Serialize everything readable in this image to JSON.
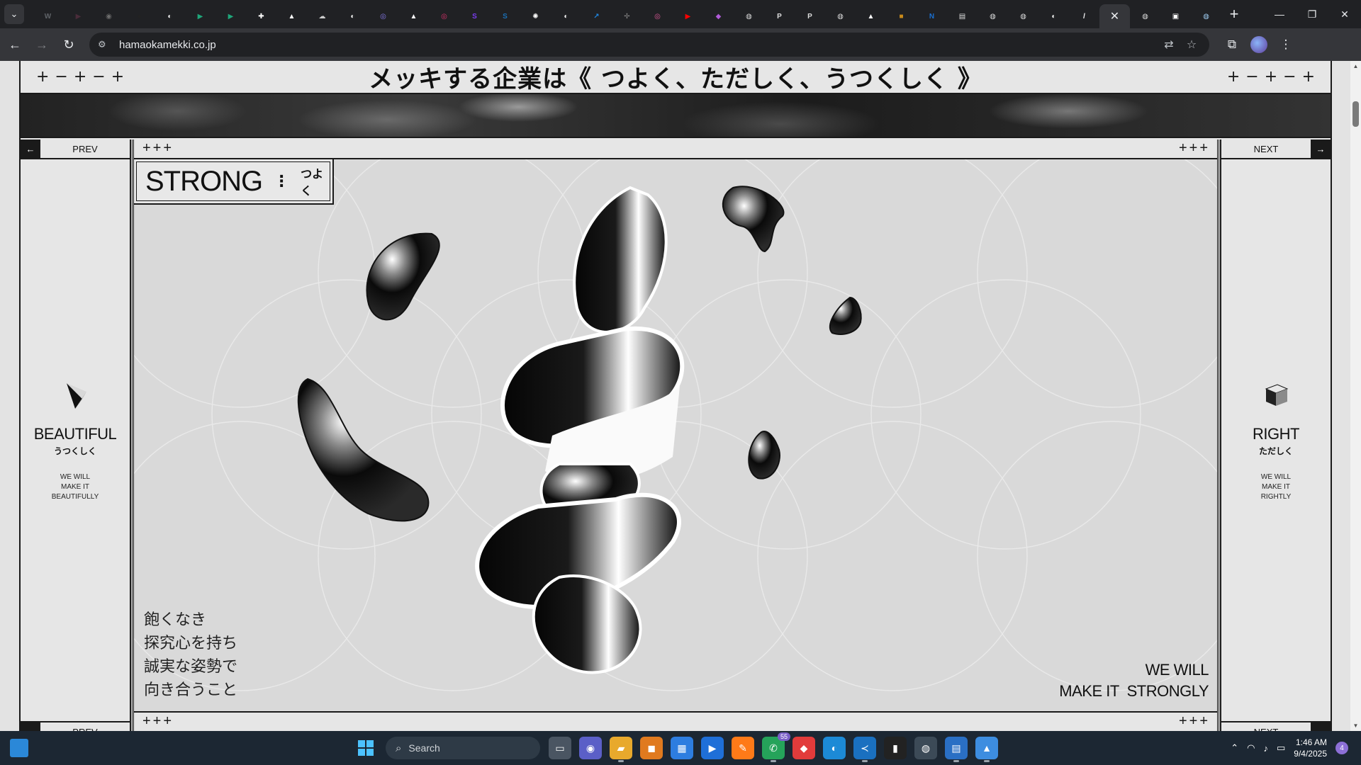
{
  "browser": {
    "tabs": [
      {
        "icon": "tab-search",
        "color": "#5f6368"
      },
      {
        "icon": "w-logo-icon",
        "glyph": "W",
        "color": "#5f6368"
      },
      {
        "icon": "video-icon",
        "glyph": "▶",
        "color": "#4a2c3a"
      },
      {
        "icon": "circle-icon",
        "glyph": "◉",
        "color": "#6b6b6b"
      },
      {
        "icon": "dark-circle-icon",
        "glyph": "●",
        "color": "#222"
      },
      {
        "icon": "github-icon",
        "glyph": "◐",
        "color": "#ffffff"
      },
      {
        "icon": "play-icon",
        "glyph": "▶",
        "color": "#1fa67a"
      },
      {
        "icon": "play-icon",
        "glyph": "▶",
        "color": "#1fa67a"
      },
      {
        "icon": "plus-box-icon",
        "glyph": "✚",
        "color": "#ffffff"
      },
      {
        "icon": "triangle-icon",
        "glyph": "▲",
        "color": "#ffffff"
      },
      {
        "icon": "cloud-icon",
        "glyph": "☁",
        "color": "#cccccc"
      },
      {
        "icon": "github-icon",
        "glyph": "◐",
        "color": "#ffffff"
      },
      {
        "icon": "ring-icon",
        "glyph": "◎",
        "color": "#8a7cf0"
      },
      {
        "icon": "triangle-icon",
        "glyph": "▲",
        "color": "#ffffff"
      },
      {
        "icon": "instagram-icon",
        "glyph": "◎",
        "color": "#e1306c"
      },
      {
        "icon": "s-logo-icon",
        "glyph": "S",
        "color": "#7a3cf0"
      },
      {
        "icon": "s-box-icon",
        "glyph": "S",
        "color": "#1b6fb5"
      },
      {
        "icon": "openai-icon",
        "glyph": "✺",
        "color": "#ffffff"
      },
      {
        "icon": "github-icon",
        "glyph": "◐",
        "color": "#ffffff"
      },
      {
        "icon": "chart-icon",
        "glyph": "↗",
        "color": "#1e88e5"
      },
      {
        "icon": "puzzle-icon",
        "glyph": "✢",
        "color": "#888888"
      },
      {
        "icon": "ring-icon",
        "glyph": "◎",
        "color": "#e05a9a"
      },
      {
        "icon": "youtube-icon",
        "glyph": "▶",
        "color": "#ff0000"
      },
      {
        "icon": "gradient-icon",
        "glyph": "◆",
        "color": "#b05ad8"
      },
      {
        "icon": "globe-icon",
        "glyph": "◍",
        "color": "#dddddd"
      },
      {
        "icon": "p-icon",
        "glyph": "P",
        "color": "#dddddd"
      },
      {
        "icon": "p-icon",
        "glyph": "P",
        "color": "#dddddd"
      },
      {
        "icon": "globe-icon",
        "glyph": "◍",
        "color": "#dddddd"
      },
      {
        "icon": "triangle-icon",
        "glyph": "▲",
        "color": "#ffffff"
      },
      {
        "icon": "orange-box-icon",
        "glyph": "■",
        "color": "#c98a1a"
      },
      {
        "icon": "n-box-icon",
        "glyph": "N",
        "color": "#1a6fd0"
      },
      {
        "icon": "news-icon",
        "glyph": "▤",
        "color": "#dddddd"
      },
      {
        "icon": "globe-icon",
        "glyph": "◍",
        "color": "#dddddd"
      },
      {
        "icon": "globe-icon",
        "glyph": "◍",
        "color": "#dddddd"
      },
      {
        "icon": "github-icon",
        "glyph": "◐",
        "color": "#ffffff"
      },
      {
        "icon": "slash-box-icon",
        "glyph": "/",
        "color": "#ffffff"
      },
      {
        "icon": "close-icon",
        "glyph": "✕",
        "color": "#e8eaed",
        "active": true
      },
      {
        "icon": "globe-icon",
        "glyph": "◍",
        "color": "#dddddd"
      },
      {
        "icon": "image-box-icon",
        "glyph": "▣",
        "color": "#ffffff"
      },
      {
        "icon": "pin-icon",
        "glyph": "◍",
        "color": "#9ecbf0"
      }
    ],
    "url": "hamaokamekki.co.jp"
  },
  "page": {
    "headline": "メッキする企業は《 つよく、ただしく、うつくしく 》",
    "plus_minus": "+−+−+",
    "left_panel": {
      "prev_label": "PREV",
      "title": "BEAUTIFUL",
      "jp": "うつくしく",
      "desc": [
        "WE WILL",
        "MAKE IT",
        "BEAUTIFULLY"
      ]
    },
    "right_panel": {
      "next_label": "NEXT",
      "title": "RIGHT",
      "jp": "ただしく",
      "desc": [
        "WE WILL",
        "MAKE IT",
        "RIGHTLY"
      ]
    },
    "main": {
      "pluses": "+++",
      "title": "STRONG",
      "dots": "⋮",
      "jp": "つよく",
      "poem": [
        "飽くなき",
        "探究心を持ち",
        "誠実な姿勢で",
        "向き合うこと"
      ],
      "motto": [
        "WE WILL",
        "MAKE IT  STRONGLY"
      ]
    }
  },
  "taskbar": {
    "search_placeholder": "Search",
    "whatsapp_badge": "55",
    "time": "1:46 AM",
    "date": "9/4/2025",
    "notifications": "4"
  }
}
